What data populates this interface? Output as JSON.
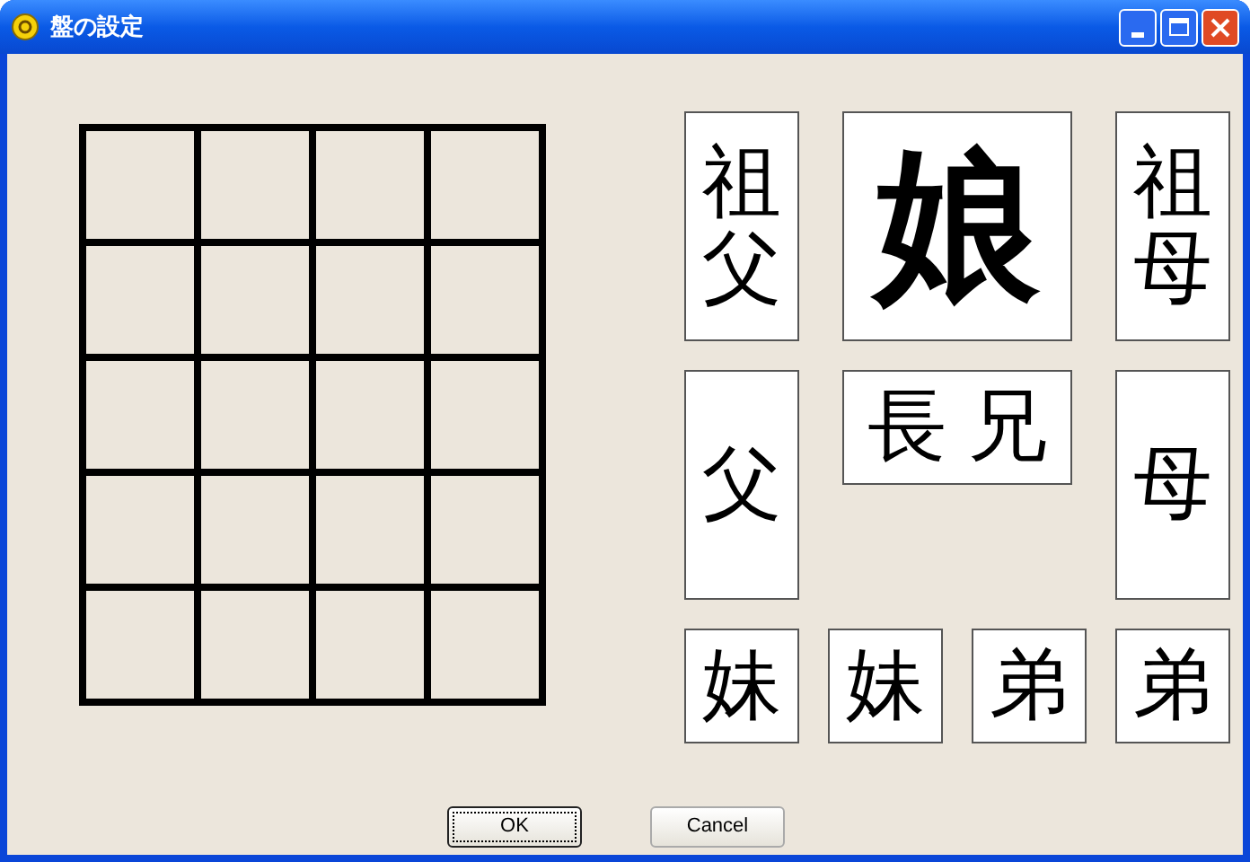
{
  "window": {
    "title": "盤の設定"
  },
  "pieces_rows": [
    [
      {
        "label": "祖父",
        "kind": "tall"
      },
      {
        "label": "娘",
        "kind": "big"
      },
      {
        "label": "祖母",
        "kind": "tall"
      }
    ],
    [
      {
        "label": "父",
        "kind": "tall"
      },
      {
        "label": "長 兄",
        "kind": "wide"
      },
      {
        "label": "母",
        "kind": "tall"
      }
    ],
    [
      {
        "label": "妹",
        "kind": "small"
      },
      {
        "label": "妹",
        "kind": "small"
      },
      {
        "label": "弟",
        "kind": "small"
      },
      {
        "label": "弟",
        "kind": "small"
      }
    ]
  ],
  "buttons": [
    {
      "label": "OK",
      "default": true
    },
    {
      "label": "Cancel",
      "default": false
    }
  ]
}
